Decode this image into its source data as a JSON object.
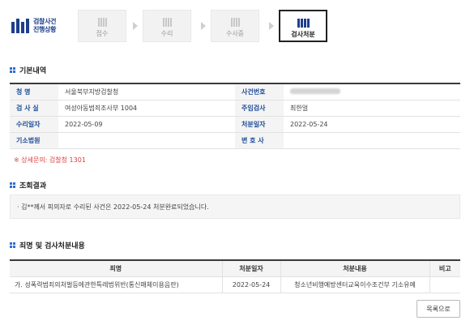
{
  "progress": {
    "title_line1": "검찰사건",
    "title_line2": "진행상황",
    "steps": [
      {
        "label": "접수",
        "active": false
      },
      {
        "label": "수리",
        "active": false
      },
      {
        "label": "수사중",
        "active": false
      },
      {
        "label": "검사처분",
        "active": true
      }
    ]
  },
  "basic_info": {
    "title": "기본내역",
    "rows": [
      {
        "k1": "청   명",
        "v1": "서울북부지방검찰청",
        "k2": "사건번호",
        "v2": ""
      },
      {
        "k1": "검 사 실",
        "v1": "여성아동범죄조사부 1004",
        "k2": "주임검사",
        "v2": "최한얼"
      },
      {
        "k1": "수리일자",
        "v1": "2022-05-09",
        "k2": "처분일자",
        "v2": "2022-05-24"
      },
      {
        "k1": "기소법원",
        "v1": "",
        "k2": "변 호 사",
        "v2": ""
      }
    ],
    "note": "※ 상세문의: 검찰청 1301"
  },
  "result": {
    "title": "조회결과",
    "text": "· 김**께서 피의자로 수리된 사건은 2022-05-24 처분완료되었습니다."
  },
  "offense": {
    "title": "죄명 및 검사처분내용",
    "headers": [
      "죄명",
      "처분일자",
      "처분내용",
      "비고"
    ],
    "rows": [
      {
        "crime": "가. 성폭력범죄의처벌등에관한특례법위반(통신매체이용음란)",
        "date": "2022-05-24",
        "disposition": "청소년비행예방센터교육이수조건부 기소유예",
        "remark": ""
      }
    ]
  },
  "back_button": "목록으로",
  "colors": {
    "accent": "#1d3f8c",
    "label_blue": "#1f4c98",
    "note_red": "#e23b3b"
  }
}
